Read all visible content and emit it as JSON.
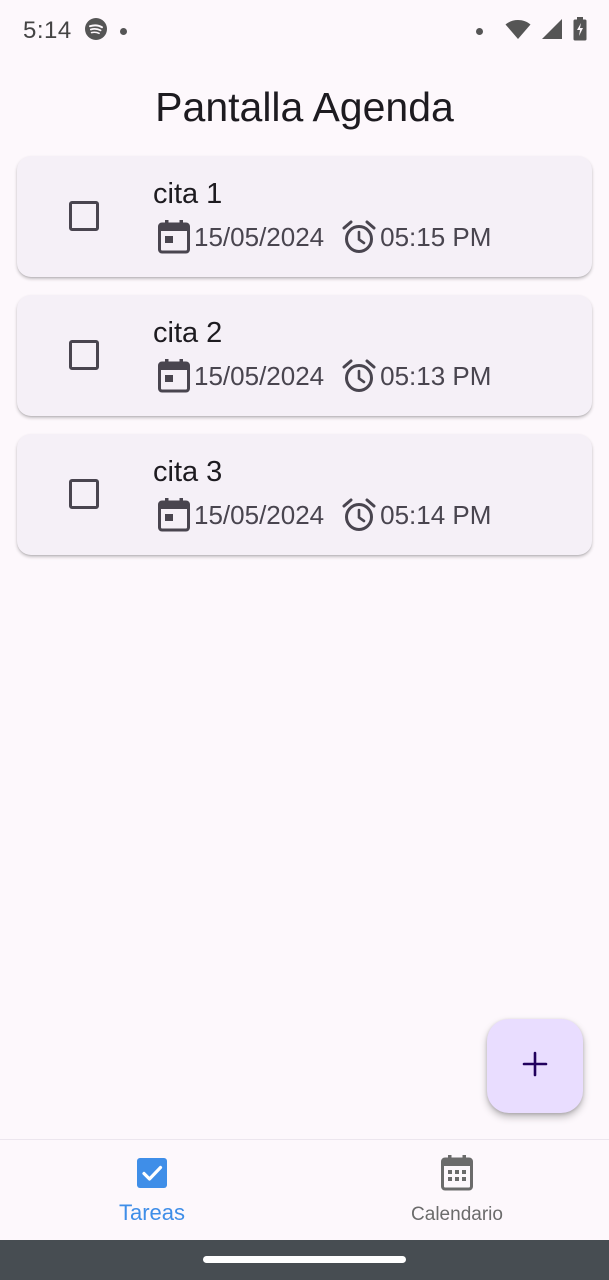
{
  "status_bar": {
    "time": "5:14",
    "icons": [
      "spotify-icon",
      "notification-dot",
      "notification-dot",
      "wifi-icon",
      "signal-icon",
      "battery-icon"
    ]
  },
  "page": {
    "title": "Pantalla Agenda"
  },
  "tasks": [
    {
      "title": "cita 1",
      "date": "15/05/2024",
      "time": "05:15 PM",
      "checked": false
    },
    {
      "title": "cita 2",
      "date": "15/05/2024",
      "time": "05:13 PM",
      "checked": false
    },
    {
      "title": "cita 3",
      "date": "15/05/2024",
      "time": "05:14 PM",
      "checked": false
    }
  ],
  "fab": {
    "icon": "plus-icon"
  },
  "bottom_nav": {
    "items": [
      {
        "label": "Tareas",
        "icon": "checkbox-checked-icon",
        "active": true
      },
      {
        "label": "Calendario",
        "icon": "calendar-icon",
        "active": false
      }
    ]
  },
  "colors": {
    "accent": "#3f8ee8",
    "card_background": "#f5f0f7",
    "fab_background": "#e9ddff",
    "fab_icon": "#21005d",
    "page_background": "#fdf8fc"
  }
}
